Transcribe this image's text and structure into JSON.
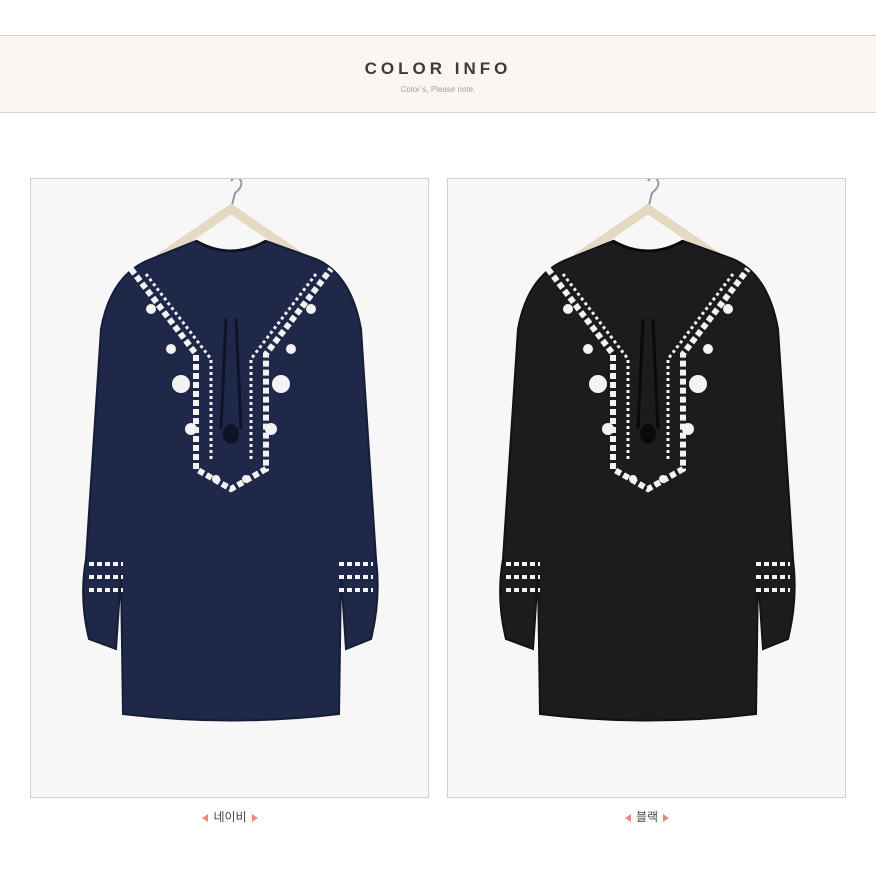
{
  "header": {
    "title": "COLOR INFO",
    "subtitle": "Color`s, Please note."
  },
  "products": [
    {
      "label": "네이비",
      "shirt_color": "#1f2848",
      "shadow_color": "#161d36"
    },
    {
      "label": "블랙",
      "shirt_color": "#1c1c1f",
      "shadow_color": "#121214"
    }
  ],
  "colors": {
    "accent": "#e88a7d",
    "embroidery": "#f3f3f3"
  }
}
